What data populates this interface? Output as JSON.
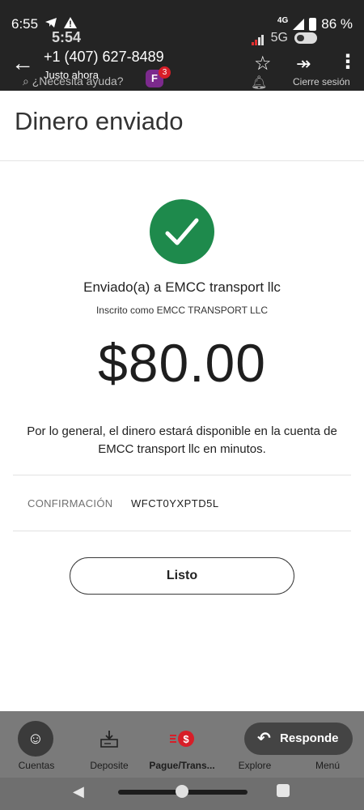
{
  "status_bar": {
    "time": "6:55",
    "network": "4G",
    "battery": "86 %"
  },
  "overlay": {
    "time": "5:54",
    "network": "5G"
  },
  "notification": {
    "phone_number": "+1 (407) 627-8489",
    "subtitle": "Justo ahora"
  },
  "app_header": {
    "help_placeholder": "¿Necesita ayuda?",
    "help_badge_count": "3",
    "logout_label": "Cierre sesión"
  },
  "page": {
    "title": "Dinero enviado"
  },
  "confirmation": {
    "sent_to": "Enviado(a) a EMCC transport llc",
    "enrolled_as": "Inscrito como EMCC TRANSPORT LLC",
    "amount": "$80.00",
    "availability": "Por lo general, el dinero estará disponible en la cuenta de EMCC transport llc en minutos.",
    "label": "CONFIRMACIÓN",
    "code": "WFCT0YXPTD5L",
    "done_button": "Listo"
  },
  "bottom_nav": {
    "items": [
      {
        "label": "Cuentas",
        "icon": "accounts-icon"
      },
      {
        "label": "Deposite",
        "icon": "deposit-icon"
      },
      {
        "label": "Pague/Trans...",
        "icon": "pay-transfer-icon"
      },
      {
        "label": "Explore",
        "icon": "explore-icon"
      },
      {
        "label": "Menú",
        "icon": "menu-icon"
      }
    ],
    "reply_label": "Responde"
  },
  "colors": {
    "success_green": "#1e8a4c",
    "brand_red": "#d71e28"
  }
}
